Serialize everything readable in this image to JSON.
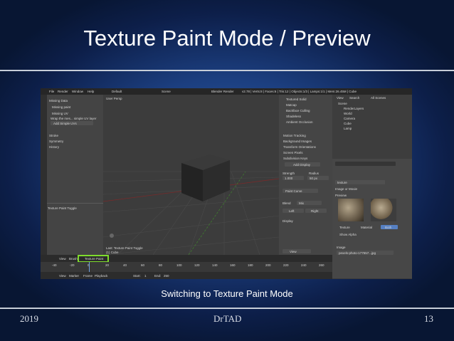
{
  "slide": {
    "title": "Texture Paint Mode / Preview",
    "caption": "Switching to Texture Paint Mode",
    "footer": {
      "year": "2019",
      "author": "DrTAD",
      "page": "13"
    }
  },
  "screenshot": {
    "menu": [
      "File",
      "Render",
      "Window",
      "Help"
    ],
    "screen": "Default",
    "scene": "Scene",
    "engine": "Blender Render",
    "stats": "v2.78 | Verts:8 | Faces:6 | Tris:12 | Objects:1/3 | Lamps:1/1 | Mem:26.45M | Cube",
    "tool_panel": {
      "items": [
        "Missing Data",
        "Missing paint",
        "Missing UV",
        "Wrap the mes... simple UV layer",
        "Add Simple UVs",
        "Stroke",
        "Symmetry",
        "History"
      ],
      "toggle": "Texture Paint Toggle"
    },
    "viewport": {
      "label": "User Persp",
      "last_op": "Last: Texture Paint Toggle",
      "object": "(1) Cube"
    },
    "props": {
      "items": [
        "Textured Solid",
        "Matcap",
        "Backface Culling",
        "Shadeless",
        "Ambient Occlusion",
        "Motion Tracking",
        "Background Images",
        "Transform Orientations",
        "Screen Pixels",
        "Subdivision Keys",
        "Add Display"
      ],
      "values": [
        "Strength",
        "1.000",
        "Radius",
        "50 px",
        "Paint Curve",
        "Blend",
        "Mix",
        "Left",
        "Right",
        "Display",
        "View"
      ]
    },
    "outliner": {
      "tabs": [
        "View",
        "Search",
        "All Scenes"
      ],
      "items": [
        "Scene",
        "RenderLayers",
        "World",
        "Camera",
        "Cube",
        "Lamp"
      ]
    },
    "texture_panel": {
      "name": "texture",
      "type": "Image or Movie",
      "section": "Preview",
      "tabs": [
        "Texture",
        "Material",
        "Both"
      ],
      "alpha": "Show Alpha",
      "image": "Image",
      "file": "pexels-photo-177557...jpg"
    },
    "mode_bar": [
      "View",
      "Brush",
      "Texture Paint"
    ],
    "timeline_bar": [
      "View",
      "Marker",
      "Frame",
      "Playback",
      "Start:",
      "1",
      "End:",
      "250"
    ],
    "ticks": [
      "-40",
      "-20",
      "0",
      "20",
      "40",
      "60",
      "80",
      "100",
      "120",
      "140",
      "160",
      "180",
      "200",
      "220",
      "240",
      "260"
    ]
  }
}
